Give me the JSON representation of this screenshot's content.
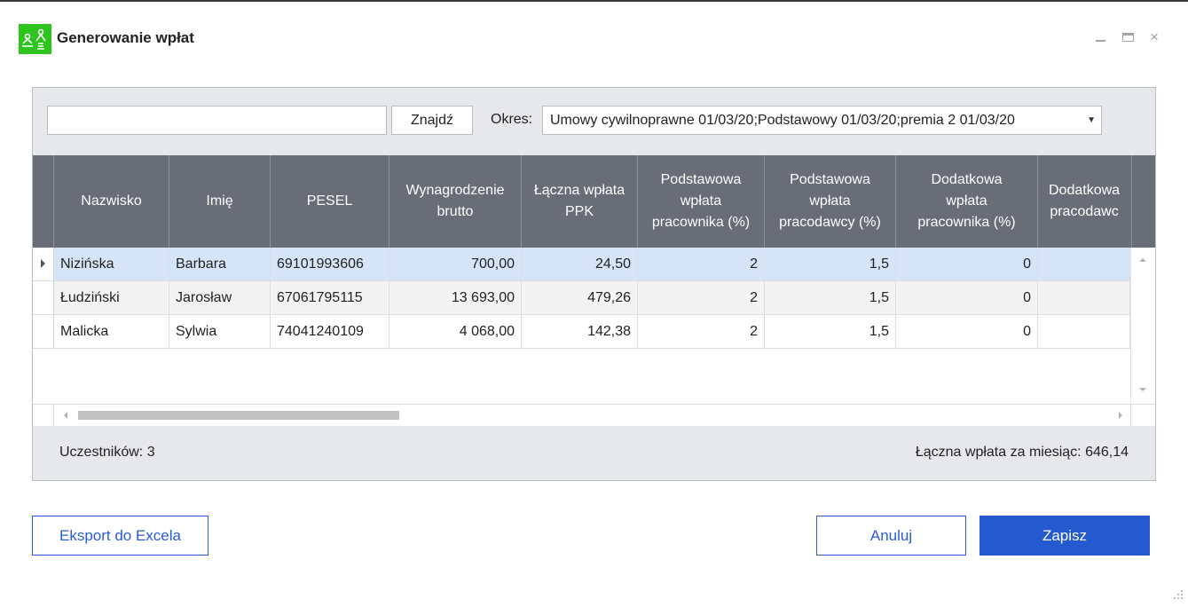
{
  "window": {
    "title": "Generowanie wpłat",
    "icon": "app-logo-icon",
    "controls": [
      "minimize-icon",
      "maximize-icon",
      "close-icon"
    ],
    "close_glyph": "×"
  },
  "toolbar": {
    "search_value": "",
    "find_label": "Znajdź",
    "period_label": "Okres:",
    "period_value": "Umowy cywilnoprawne 01/03/20;Podstawowy 01/03/20;premia 2 01/03/20"
  },
  "table": {
    "columns": [
      "Nazwisko",
      "Imię",
      "PESEL",
      "Wynagrodzenie\nbrutto",
      "Łączna wpłata\nPPK",
      "Podstawowa\nwpłata\npracownika (%)",
      "Podstawowa\nwpłata\npracodawcy (%)",
      "Dodatkowa\nwpłata\npracownika (%)",
      "Dodatkowa\npracodawc"
    ],
    "rows": [
      [
        "Nizińska",
        "Barbara",
        "69101993606",
        "700,00",
        "24,50",
        "2",
        "1,5",
        "0",
        ""
      ],
      [
        "Łudziński",
        "Jarosław",
        "67061795115",
        "13 693,00",
        "479,26",
        "2",
        "1,5",
        "0",
        ""
      ],
      [
        "Malicka",
        "Sylwia",
        "74041240109",
        "4 068,00",
        "142,38",
        "2",
        "1,5",
        "0",
        ""
      ]
    ],
    "selected_row": 0
  },
  "summary": {
    "participants": "Uczestników: 3",
    "total": "Łączna wpłata za miesiąc: 646,14"
  },
  "buttons": {
    "export": "Eksport do Excela",
    "cancel": "Anuluj",
    "save": "Zapisz"
  },
  "colors": {
    "accent": "#2459d0",
    "header_bg": "#686d77",
    "selected_row": "#d5e4f7",
    "app_icon": "#2ec41e"
  }
}
